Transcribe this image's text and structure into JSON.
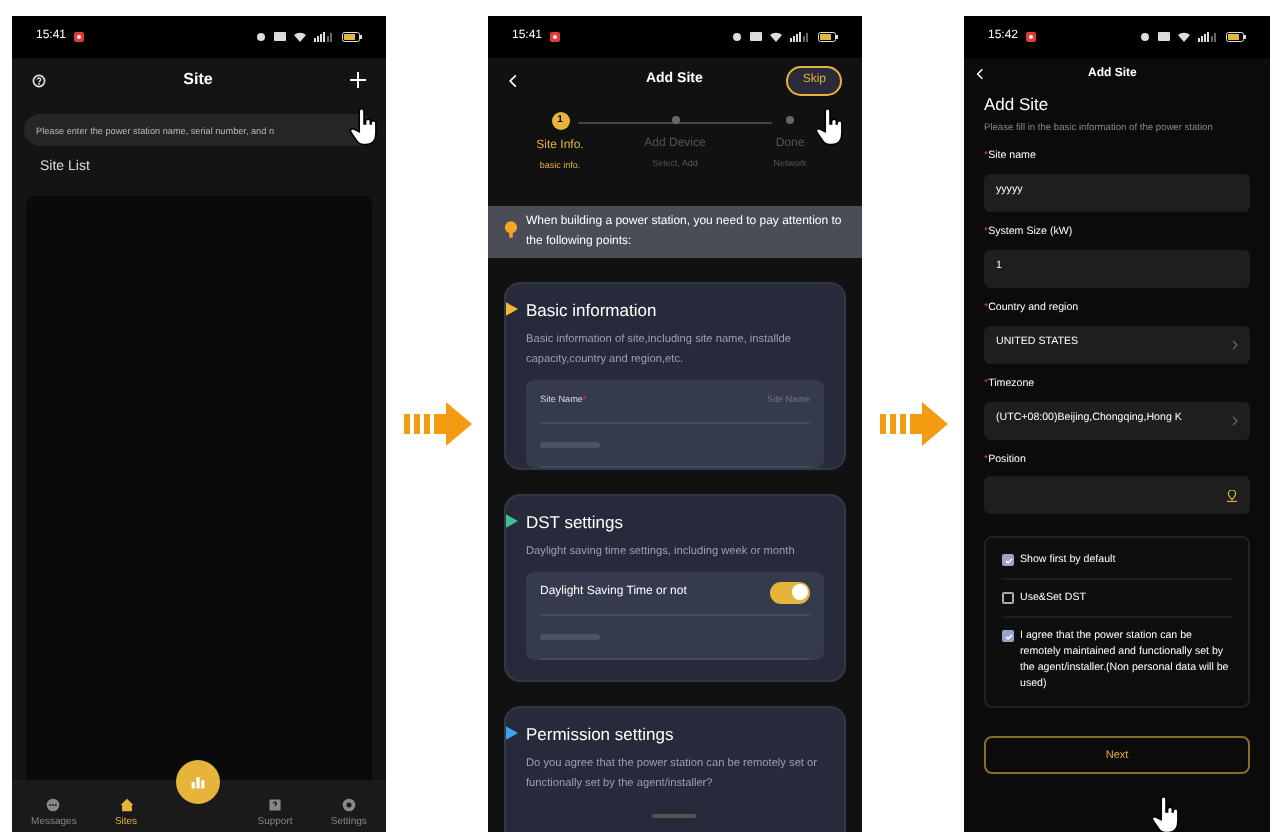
{
  "site_screen": {
    "status_time": "15:41",
    "title": "Site",
    "search_placeholder": "Please enter the power station name, serial number, and n",
    "section_title": "Site List",
    "nav": [
      {
        "label": "Messages",
        "selected": false
      },
      {
        "label": "Sites",
        "selected": true
      },
      {
        "label": "Support",
        "selected": false
      },
      {
        "label": "Settings",
        "selected": false
      }
    ]
  },
  "intro_screen": {
    "status_time": "15:41",
    "title": "Add Site",
    "skip_label": "Skip",
    "steps": [
      {
        "number": "1",
        "title": "Site Info.",
        "subtitle": "basic info.",
        "selected": true
      },
      {
        "title": "Add Device",
        "subtitle": "Select, Add",
        "selected": false
      },
      {
        "title": "Done",
        "subtitle": "Network",
        "selected": false
      }
    ],
    "notice": "When building a power station, you need to pay attention to the following points:",
    "cards": [
      {
        "title": "Basic information",
        "color": "#f5b731",
        "description": "Basic information of site,including site name, installde capacity,country and region,etc.",
        "rows": [
          {
            "kind": "field",
            "label": "Site Name",
            "required_mark": "*",
            "placeholder": "Site Name"
          },
          {
            "kind": "blurred"
          }
        ]
      },
      {
        "title": "DST settings",
        "color": "#3ec28f",
        "description": "Daylight saving time settings, including week or month",
        "rows": [
          {
            "kind": "toggle",
            "label": "Daylight Saving Time or not",
            "on": true
          },
          {
            "kind": "blurred"
          }
        ]
      },
      {
        "title": "Permission settings",
        "color": "#3aa8e8",
        "description": "Do you agree that the power station can be remotely set or functionally set by the agent/installer?"
      }
    ]
  },
  "form_screen": {
    "status_time": "15:42",
    "title": "Add Site",
    "heading": "Add Site",
    "subtitle": "Please fill in the basic information of the power station",
    "fields": [
      {
        "kind": "text",
        "required_mark": "*",
        "label": "Site name",
        "value": "yyyyy"
      },
      {
        "kind": "text",
        "required_mark": "*",
        "label": "System Size (kW)",
        "value": "1"
      },
      {
        "kind": "select",
        "required_mark": "*",
        "label": "Country and region",
        "value": "UNITED STATES"
      },
      {
        "kind": "select",
        "required_mark": "*",
        "label": "Timezone",
        "value": "(UTC+08:00)Beijing,Chongqing,Hong K"
      },
      {
        "kind": "location",
        "required_mark": "*",
        "label": "Position"
      }
    ],
    "checkboxes": [
      {
        "label": "Show first by default",
        "checked": true
      },
      {
        "label": "Use&Set DST",
        "checked": false
      },
      {
        "label": "I agree that the power station can be remotely maintained and functionally set by the agent/installer.(Non personal data will be used)",
        "checked": true
      }
    ],
    "button": "Next"
  }
}
